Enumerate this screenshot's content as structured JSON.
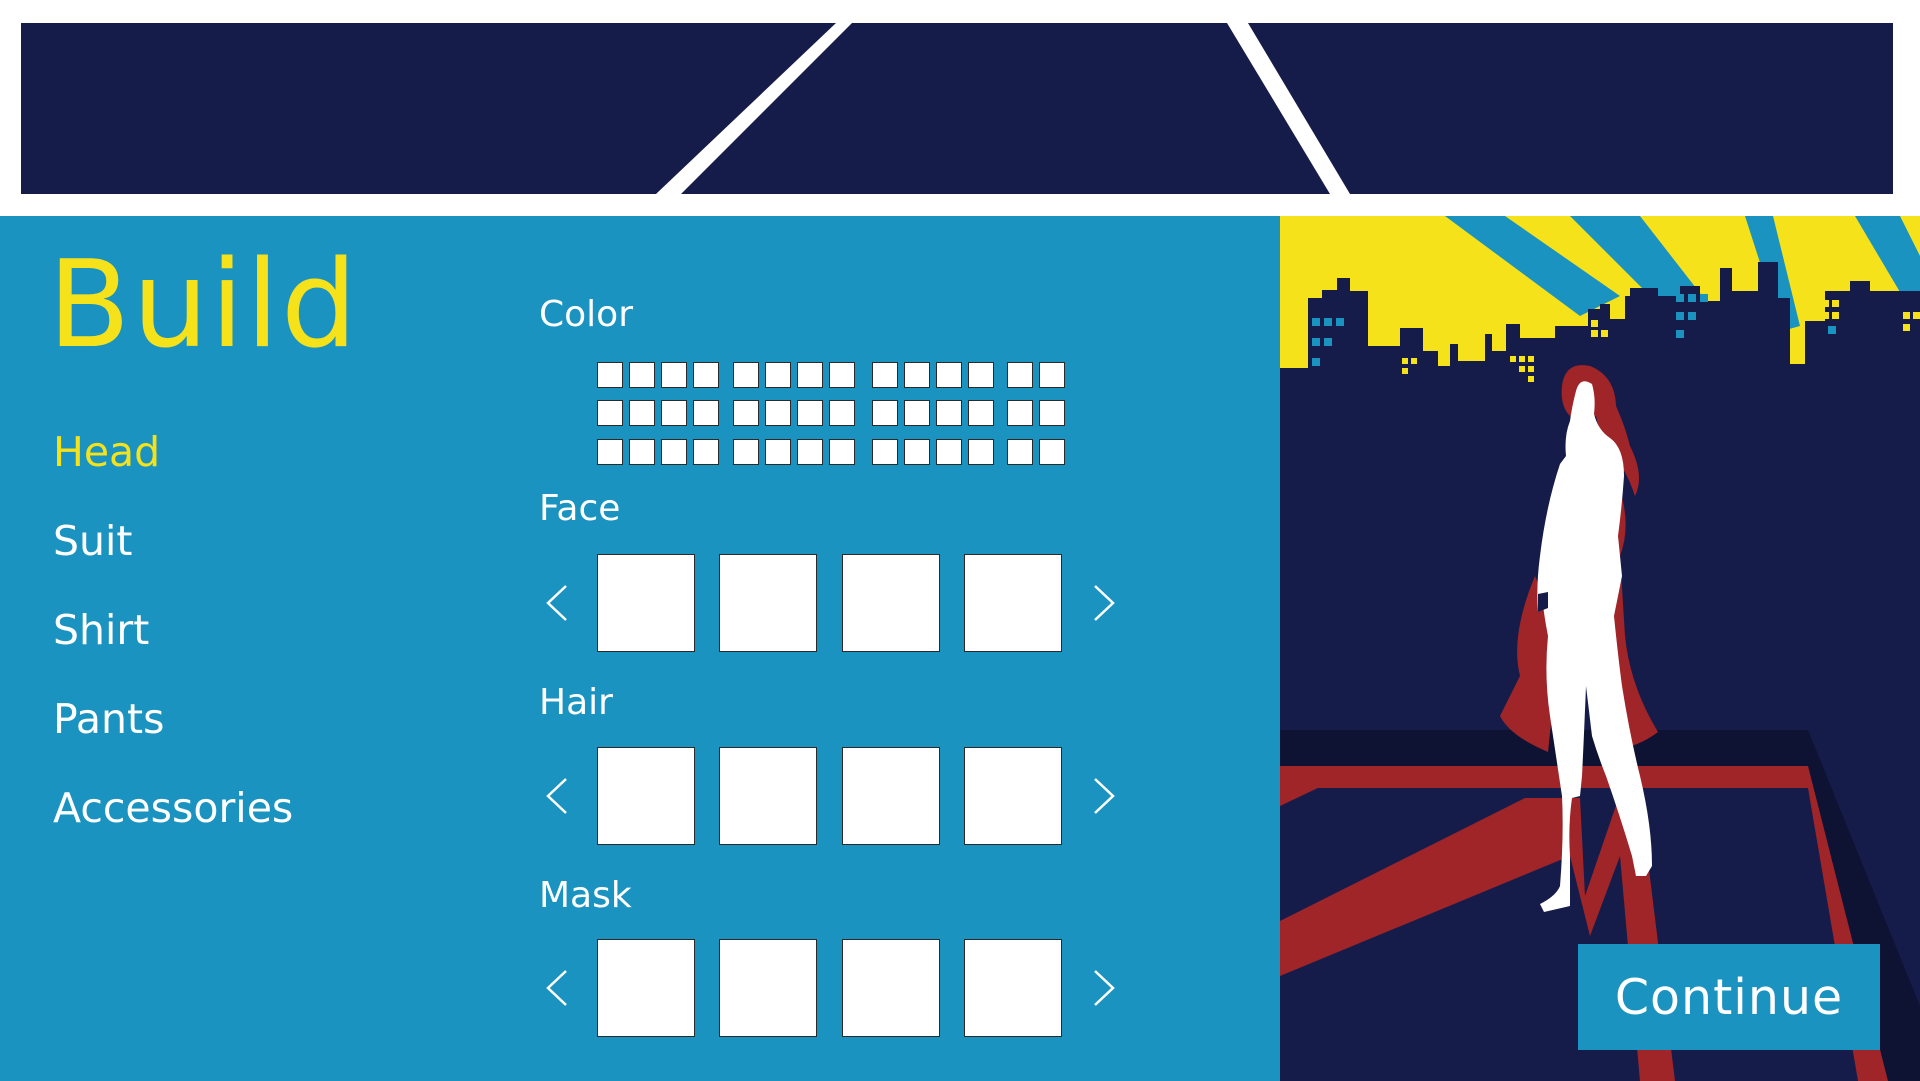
{
  "colors": {
    "navy": "#161c4a",
    "panel_blue": "#1a93c1",
    "accent_yellow": "#f6e21b",
    "cape_red": "#9f2528",
    "white": "#ffffff"
  },
  "title": "Build",
  "nav": {
    "items": [
      {
        "label": "Head",
        "active": true
      },
      {
        "label": "Suit",
        "active": false
      },
      {
        "label": "Shirt",
        "active": false
      },
      {
        "label": "Pants",
        "active": false
      },
      {
        "label": "Accessories",
        "active": false
      }
    ]
  },
  "sections": {
    "color": {
      "label": "Color",
      "rows": 3,
      "swatches_per_row": 14
    },
    "face": {
      "label": "Face",
      "options_visible": 4,
      "prev_icon": "chevron-left-icon",
      "next_icon": "chevron-right-icon"
    },
    "hair": {
      "label": "Hair",
      "options_visible": 4,
      "prev_icon": "chevron-left-icon",
      "next_icon": "chevron-right-icon"
    },
    "mask": {
      "label": "Mask",
      "options_visible": 4,
      "prev_icon": "chevron-left-icon",
      "next_icon": "chevron-right-icon"
    }
  },
  "preview": {
    "scene": "superhero-rooftop-skyline-illustration"
  },
  "continue_label": "Continue"
}
